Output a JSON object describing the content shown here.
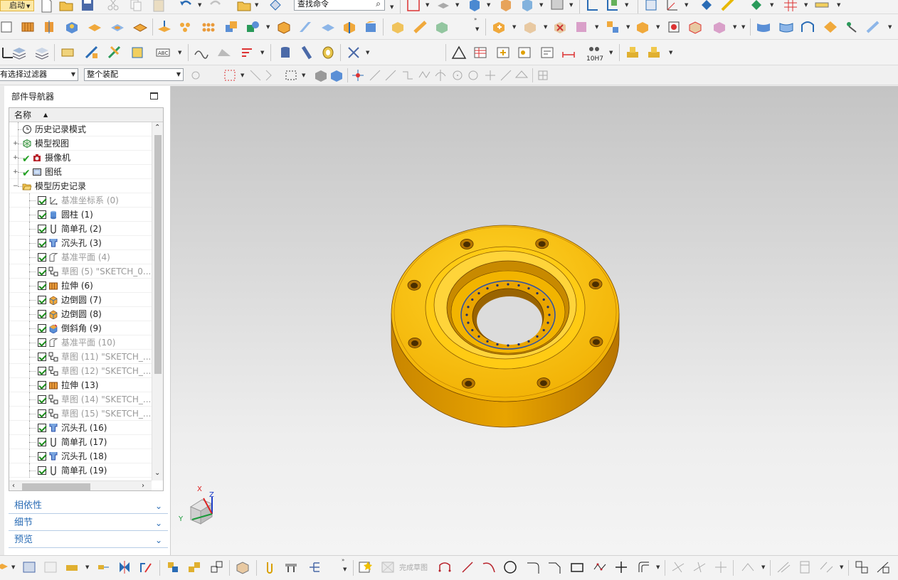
{
  "toolbar": {
    "start_label": "启动",
    "find_placeholder": "查找命令"
  },
  "selection_bar": {
    "filter_value": "有选择过滤器",
    "scope_value": "整个装配"
  },
  "sketch_bar": {
    "finish_sketch_label": "完成草图",
    "hint_label": "10H7"
  },
  "navigator": {
    "title": "部件导航器",
    "column_name": "名称",
    "items": [
      {
        "label": "历史记录模式",
        "icon": "clock-icon",
        "checked": false,
        "greyed": false,
        "level": 0
      },
      {
        "label": "模型视图",
        "icon": "model-views-icon",
        "checked": false,
        "greyed": false,
        "level": 0
      },
      {
        "label": "摄像机",
        "icon": "camera-icon",
        "checked": true,
        "greyed": false,
        "level": 0
      },
      {
        "label": "图纸",
        "icon": "drawing-icon",
        "checked": true,
        "greyed": false,
        "level": 0
      },
      {
        "label": "模型历史记录",
        "icon": "folder-open-icon",
        "checked": false,
        "greyed": false,
        "level": 0
      },
      {
        "label": "基准坐标系 (0)",
        "icon": "datum-csys-icon",
        "checked": true,
        "greyed": true,
        "level": 1
      },
      {
        "label": "圆柱 (1)",
        "icon": "cylinder-icon",
        "checked": true,
        "greyed": false,
        "level": 1
      },
      {
        "label": "简单孔 (2)",
        "icon": "simple-hole-icon",
        "checked": true,
        "greyed": false,
        "level": 1
      },
      {
        "label": "沉头孔 (3)",
        "icon": "counterbore-hole-icon",
        "checked": true,
        "greyed": false,
        "level": 1
      },
      {
        "label": "基准平面 (4)",
        "icon": "datum-plane-icon",
        "checked": true,
        "greyed": true,
        "level": 1
      },
      {
        "label": "草图 (5) \"SKETCH_0...",
        "icon": "sketch-icon",
        "checked": true,
        "greyed": true,
        "level": 1
      },
      {
        "label": "拉伸 (6)",
        "icon": "extrude-icon",
        "checked": true,
        "greyed": false,
        "level": 1
      },
      {
        "label": "边倒圆 (7)",
        "icon": "edge-blend-icon",
        "checked": true,
        "greyed": false,
        "level": 1
      },
      {
        "label": "边倒圆 (8)",
        "icon": "edge-blend-icon",
        "checked": true,
        "greyed": false,
        "level": 1
      },
      {
        "label": "倒斜角 (9)",
        "icon": "chamfer-icon",
        "checked": true,
        "greyed": false,
        "level": 1
      },
      {
        "label": "基准平面 (10)",
        "icon": "datum-plane-icon",
        "checked": true,
        "greyed": true,
        "level": 1
      },
      {
        "label": "草图 (11) \"SKETCH_...",
        "icon": "sketch-icon",
        "checked": true,
        "greyed": true,
        "level": 1
      },
      {
        "label": "草图 (12) \"SKETCH_...",
        "icon": "sketch-icon",
        "checked": true,
        "greyed": true,
        "level": 1
      },
      {
        "label": "拉伸 (13)",
        "icon": "extrude-icon",
        "checked": true,
        "greyed": false,
        "level": 1
      },
      {
        "label": "草图 (14) \"SKETCH_...",
        "icon": "sketch-icon",
        "checked": true,
        "greyed": true,
        "level": 1
      },
      {
        "label": "草图 (15) \"SKETCH_...",
        "icon": "sketch-icon",
        "checked": true,
        "greyed": true,
        "level": 1
      },
      {
        "label": "沉头孔 (16)",
        "icon": "counterbore-hole-icon",
        "checked": true,
        "greyed": false,
        "level": 1
      },
      {
        "label": "简单孔 (17)",
        "icon": "simple-hole-icon",
        "checked": true,
        "greyed": false,
        "level": 1
      },
      {
        "label": "沉头孔 (18)",
        "icon": "counterbore-hole-icon",
        "checked": true,
        "greyed": false,
        "level": 1
      },
      {
        "label": "简单孔 (19)",
        "icon": "simple-hole-icon",
        "checked": true,
        "greyed": false,
        "level": 1
      }
    ],
    "panels": [
      {
        "label": "相依性"
      },
      {
        "label": "细节"
      },
      {
        "label": "预览"
      }
    ]
  },
  "triad": {
    "x_label": "X",
    "y_label": "Y",
    "z_label": "Z"
  },
  "colors": {
    "part": "#f5b800",
    "part_dark": "#c47d00",
    "accent_blue": "#2a6cb5",
    "viewport_top": "#c4c4c4",
    "viewport_bottom": "#f4f4f4"
  }
}
